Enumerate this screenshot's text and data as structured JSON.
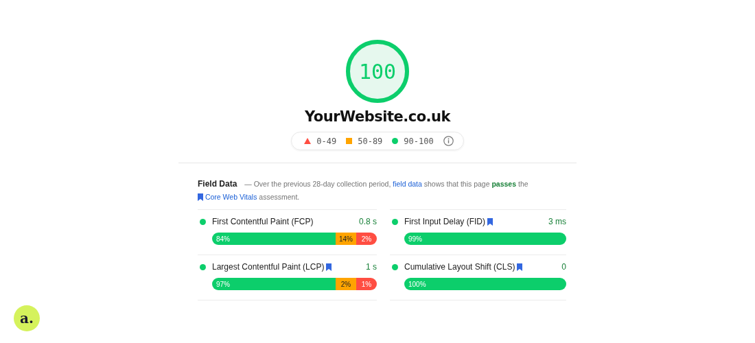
{
  "score": {
    "value": "100"
  },
  "site_title": "YourWebsite.co.uk",
  "legend": [
    {
      "kind": "fail",
      "label": "0-49"
    },
    {
      "kind": "average",
      "label": "50-89"
    },
    {
      "kind": "pass",
      "label": "90-100"
    }
  ],
  "field_data": {
    "heading": "Field Data",
    "description": [
      {
        "kind": "text",
        "text": "— Over the previous 28-day collection period,"
      },
      {
        "kind": "link",
        "text": "field data"
      },
      {
        "kind": "text",
        "text": "shows that this page"
      },
      {
        "kind": "highlight",
        "text": "passes"
      },
      {
        "kind": "text",
        "text": "the"
      }
    ],
    "link": "Core Web Vitals",
    "suffix": "assessment."
  },
  "metrics": [
    {
      "name": "First Contentful Paint (FCP)",
      "bookmark": false,
      "value": "0.8 s",
      "segments": [
        {
          "kind": "good",
          "label": "84%"
        },
        {
          "kind": "average",
          "label": "14%"
        },
        {
          "kind": "poor",
          "label": "2%"
        }
      ]
    },
    {
      "name": "First Input Delay (FID)",
      "bookmark": true,
      "value": "3 ms",
      "segments": [
        {
          "kind": "good",
          "label": "99%"
        }
      ]
    },
    {
      "name": "Largest Contentful Paint (LCP)",
      "bookmark": true,
      "value": "1 s",
      "segments": [
        {
          "kind": "good",
          "label": "97%"
        },
        {
          "kind": "average",
          "label": "2%"
        },
        {
          "kind": "poor",
          "label": "1%"
        }
      ]
    },
    {
      "name": "Cumulative Layout Shift (CLS)",
      "bookmark": true,
      "value": "0",
      "segments": [
        {
          "kind": "good",
          "label": "100%"
        }
      ]
    }
  ],
  "logo": {
    "text": "a."
  }
}
